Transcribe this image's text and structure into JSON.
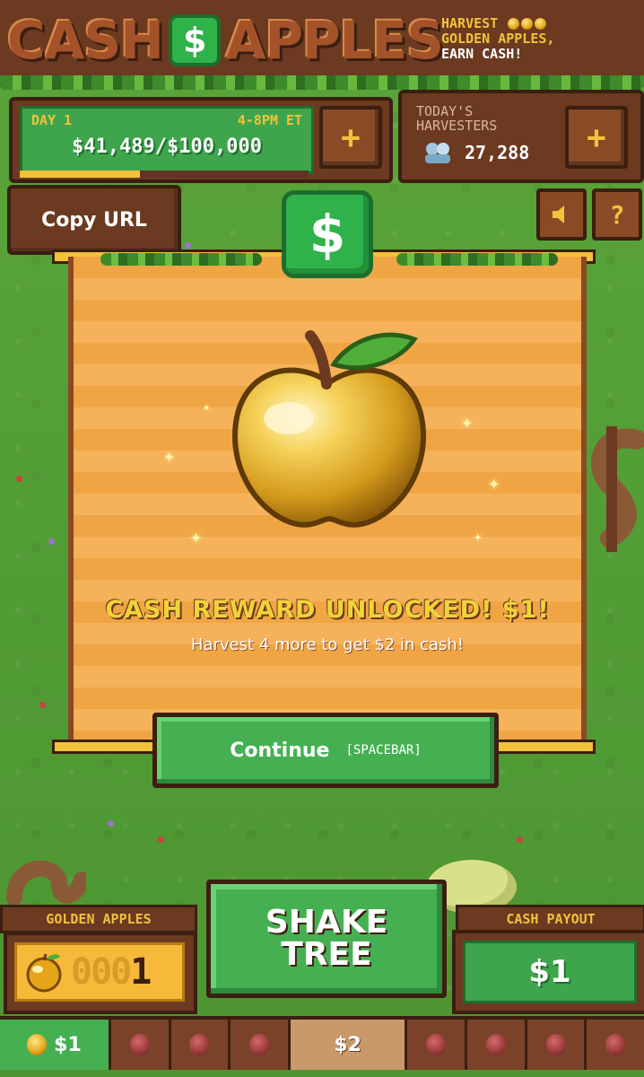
{
  "header": {
    "logo_left": "CASH",
    "logo_badge": "$",
    "logo_right": "APPLES",
    "tagline_line1": "HARVEST",
    "tagline_line2": "GOLDEN APPLES,",
    "tagline_line3": "EARN CASH!"
  },
  "progress": {
    "day": "DAY 1",
    "time": "4-8PM ET",
    "amount": "$41,489/$100,000",
    "fraction": 0.415,
    "plus_label": "+"
  },
  "harvesters": {
    "label_line1": "TODAY'S",
    "label_line2": "HARVESTERS",
    "count": "27,288",
    "plus_label": "+"
  },
  "toolbar": {
    "copy_url": "Copy URL",
    "help": "?",
    "cash_badge": "$"
  },
  "reward": {
    "title": "CASH REWARD UNLOCKED! $1!",
    "subtitle": "Harvest 4 more to get $2 in cash!",
    "continue_label": "Continue",
    "continue_hint": "[SPACEBAR]"
  },
  "golden_apples": {
    "label": "GOLDEN APPLES",
    "digits_inactive": "000",
    "digits_active": "1"
  },
  "shake": {
    "line1": "SHAKE",
    "line2": "TREE"
  },
  "payout": {
    "label": "CASH PAYOUT",
    "value": "$1"
  },
  "track": {
    "current": "$1",
    "milestone": "$2"
  },
  "colors": {
    "wood": "#6b3a20",
    "wood_dark": "#3b1f10",
    "green_button": "#45b052",
    "gold": "#f2c23a",
    "grass": "#4f9a34"
  }
}
